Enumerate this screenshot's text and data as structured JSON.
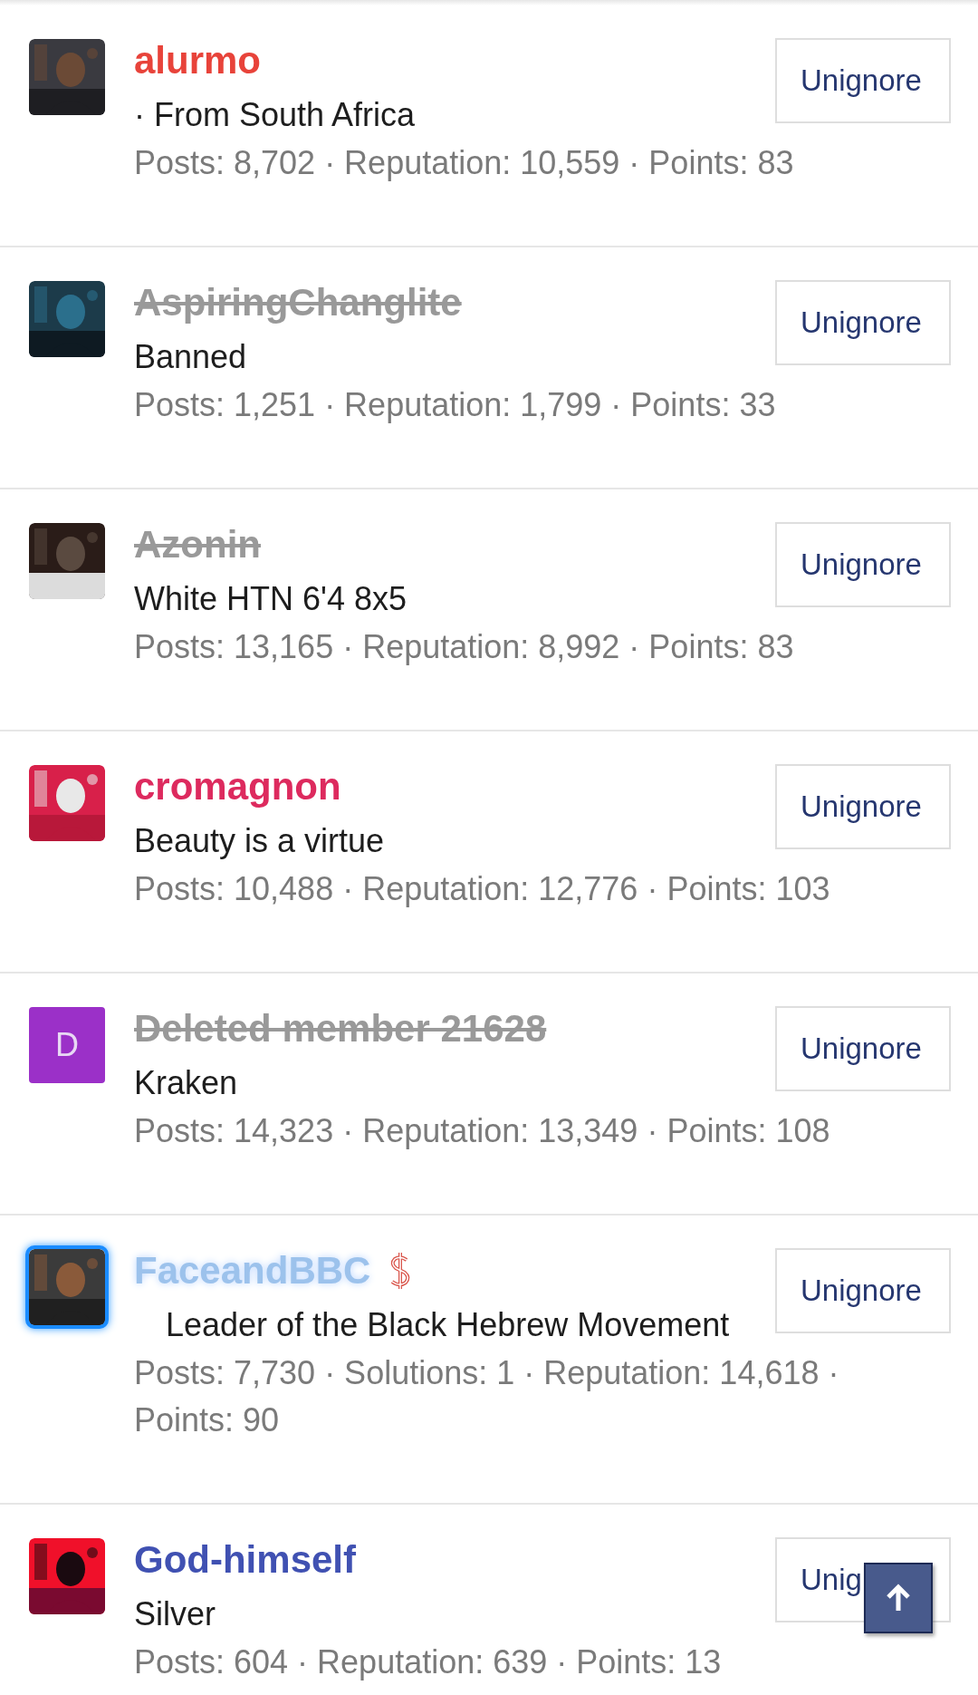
{
  "members": [
    {
      "name": {
        "text": "alurmo",
        "kind": "colored",
        "color": "#e8433a"
      },
      "avatar": {
        "kind": "picture",
        "highlighted": false
      },
      "dollar_badge": false,
      "title": "· From South Africa",
      "stats": "Posts: 8,702 · Reputation: 10,559 · Points: 83",
      "button": "Unignore"
    },
    {
      "name": {
        "text": "AspiringChanglite",
        "kind": "banned"
      },
      "avatar": {
        "kind": "picture",
        "highlighted": false
      },
      "dollar_badge": false,
      "title": "Banned",
      "stats": "Posts: 1,251 · Reputation: 1,799 · Points: 33",
      "button": "Unignore"
    },
    {
      "name": {
        "text": "Azonin",
        "kind": "banned"
      },
      "avatar": {
        "kind": "picture",
        "highlighted": false
      },
      "dollar_badge": false,
      "title": "White HTN 6'4 8x5",
      "stats": "Posts: 13,165 · Reputation: 8,992 · Points: 83",
      "button": "Unignore"
    },
    {
      "name": {
        "text": "cromagnon",
        "kind": "colored",
        "color": "#dd2a5e"
      },
      "avatar": {
        "kind": "picture",
        "highlighted": false
      },
      "dollar_badge": false,
      "title": "Beauty is a virtue",
      "stats": "Posts: 10,488 · Reputation: 12,776 · Points: 103",
      "button": "Unignore"
    },
    {
      "name": {
        "text": "Deleted member 21628",
        "kind": "banned"
      },
      "avatar": {
        "kind": "letter",
        "letter": "D",
        "color": "#9b30c8",
        "highlighted": false
      },
      "dollar_badge": false,
      "title": "Kraken",
      "stats": "Posts: 14,323 · Reputation: 13,349 · Points: 108",
      "button": "Unignore"
    },
    {
      "name": {
        "text": "FaceandBBC",
        "kind": "glow"
      },
      "avatar": {
        "kind": "picture",
        "highlighted": true
      },
      "dollar_badge": true,
      "title": "Leader of the Black Hebrew Movement",
      "stats": "Posts: 7,730 · Solutions: 1 · Reputation: 14,618 · Points: 90",
      "button": "Unignore"
    },
    {
      "name": {
        "text": "God-himself",
        "kind": "colored",
        "color": "#4051b2"
      },
      "avatar": {
        "kind": "picture",
        "highlighted": false
      },
      "dollar_badge": false,
      "title": "Silver",
      "stats": "Posts: 604 · Reputation: 639 · Points: 13",
      "button": "Unig"
    }
  ],
  "scroll_top_button": {
    "visible": true
  }
}
